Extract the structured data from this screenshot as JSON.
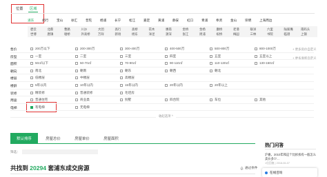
{
  "location_tabs": {
    "position": "位置",
    "area": "区域"
  },
  "districts": [
    "浦东",
    "闵行",
    "宝山",
    "徐汇",
    "普陀",
    "杨浦",
    "长宁",
    "松江",
    "嘉定",
    "黄浦",
    "静安",
    "虹口",
    "青浦",
    "奉贤",
    "金山",
    "崇明",
    "上海周边"
  ],
  "subdistricts_row1": [
    "碧云",
    "北蔡",
    "曹路",
    "川沙",
    "大团",
    "高行",
    "高桥",
    "花木",
    "惠南",
    "金桥",
    "金杨",
    "康桥",
    "老港",
    "联洋",
    "六里",
    "陆家嘴",
    "南码头"
  ],
  "subdistricts_row2": [
    "世博",
    "唐镇",
    "塘桥",
    "外高桥",
    "万祥",
    "新场",
    "杨东",
    "洋泾",
    "源深",
    "张江",
    "周浦",
    "祝桥",
    "梅园",
    "三林",
    "书院",
    "临港",
    "上钢"
  ],
  "filters": {
    "price": {
      "label": "售价",
      "options": [
        "200万以下",
        "200-300万",
        "300-400万",
        "400-500万",
        "500-800万",
        "800-1000万"
      ],
      "more": "+ 更多房价自定义"
    },
    "layout": {
      "label": "房型",
      "options": [
        "一室",
        "二室",
        "三室",
        "四室",
        "五室",
        "五室以上"
      ]
    },
    "area": {
      "label": "面积",
      "options": [
        "50㎡以下",
        "50-70㎡",
        "70-90㎡",
        "90-110㎡",
        "110-130㎡",
        "130-150㎡"
      ],
      "more": "+ 更多面积自定义"
    },
    "direction": {
      "label": "朝向",
      "options": [
        "南北",
        "朝南",
        "朝东",
        "朝西",
        "朝北"
      ]
    },
    "floor": {
      "label": "楼层",
      "options": [
        "低楼层",
        "中楼层",
        "高楼层"
      ]
    },
    "age": {
      "label": "楼龄",
      "options": [
        "5年以内",
        "10年以内",
        "15年以内",
        "20年以内",
        "20年以上"
      ]
    },
    "decoration": {
      "label": "装修",
      "options": [
        "精装修",
        "普通装修",
        "毛坯房"
      ]
    },
    "usage": {
      "label": "用途",
      "options": [
        "普通住宅",
        "商业类",
        "别墅",
        "四合院",
        "车位",
        "其他"
      ]
    },
    "elevator": {
      "label": "电梯",
      "options": [
        "有电梯",
        "无电梯"
      ],
      "checked_option": "有电梯"
    }
  },
  "collapse_label": "收起选项 ^",
  "sort_tabs": [
    "默认排序",
    "房屋总价",
    "房屋单价",
    "房屋面积"
  ],
  "active_sort": "默认排序",
  "filter_selected_label": "筛选：",
  "result": {
    "prefix": "共找到 ",
    "count": "20294",
    "suffix": " 套浦东成交房源"
  },
  "subscribe_label": "通过条件",
  "sidebar": {
    "hot_title": "热门问答",
    "question": "沪嘉，2010年和这个比拆拆有一般怎么卖价多少...",
    "meta": "1位回复 | 2018-06-07",
    "chat_text": "在线咨询"
  },
  "colors": {
    "accent": "#22aa60",
    "highlight": "#e03030"
  }
}
